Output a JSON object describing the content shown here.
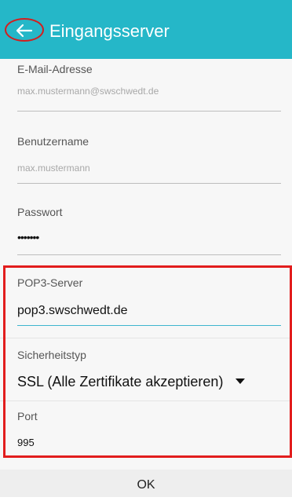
{
  "appbar": {
    "title": "Eingangsserver",
    "back_icon": "arrow-left-icon",
    "color": "#25b7c8"
  },
  "form": {
    "email": {
      "label": "E-Mail-Adresse",
      "value": "max.mustermann@swschwedt.de"
    },
    "username": {
      "label": "Benutzername",
      "value": "max.mustermann"
    },
    "password": {
      "label": "Passwort",
      "value": "•••••••"
    },
    "pop3_server": {
      "label": "POP3-Server",
      "value": "pop3.swschwedt.de"
    },
    "security_type": {
      "label": "Sicherheitstyp",
      "value": "SSL (Alle Zertifikate akzeptieren)"
    },
    "port": {
      "label": "Port",
      "value": "995"
    }
  },
  "actions": {
    "ok_label": "OK"
  },
  "highlight_color": "#e21d1d",
  "accent_color": "#3fb5cf"
}
